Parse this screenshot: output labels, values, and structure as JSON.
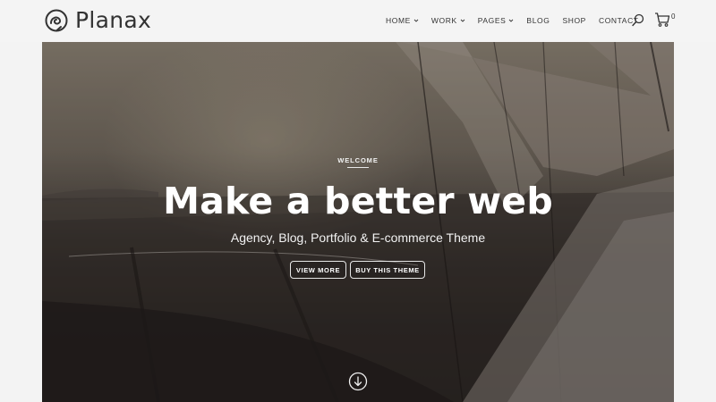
{
  "brand": {
    "name": "Planax",
    "logo_icon": "planax-logo-icon"
  },
  "nav": {
    "items": [
      {
        "label": "HOME",
        "has_dropdown": true
      },
      {
        "label": "WORK",
        "has_dropdown": true
      },
      {
        "label": "PAGES",
        "has_dropdown": true
      },
      {
        "label": "BLOG",
        "has_dropdown": false
      },
      {
        "label": "SHOP",
        "has_dropdown": false
      },
      {
        "label": "CONTACT",
        "has_dropdown": false
      }
    ],
    "search_icon": "search-icon",
    "cart_icon": "cart-icon",
    "cart_count": "0"
  },
  "hero": {
    "eyebrow": "WELCOME",
    "headline": "Make a better web",
    "subheadline": "Agency, Blog, Portfolio & E-commerce Theme",
    "primary_button": "VIEW MORE",
    "secondary_button": "BUY THIS THEME",
    "scroll_icon": "arrow-down-circle-icon"
  },
  "colors": {
    "header_bg": "#f4f4f4",
    "text_dark": "#333333",
    "hero_text": "#ffffff"
  }
}
